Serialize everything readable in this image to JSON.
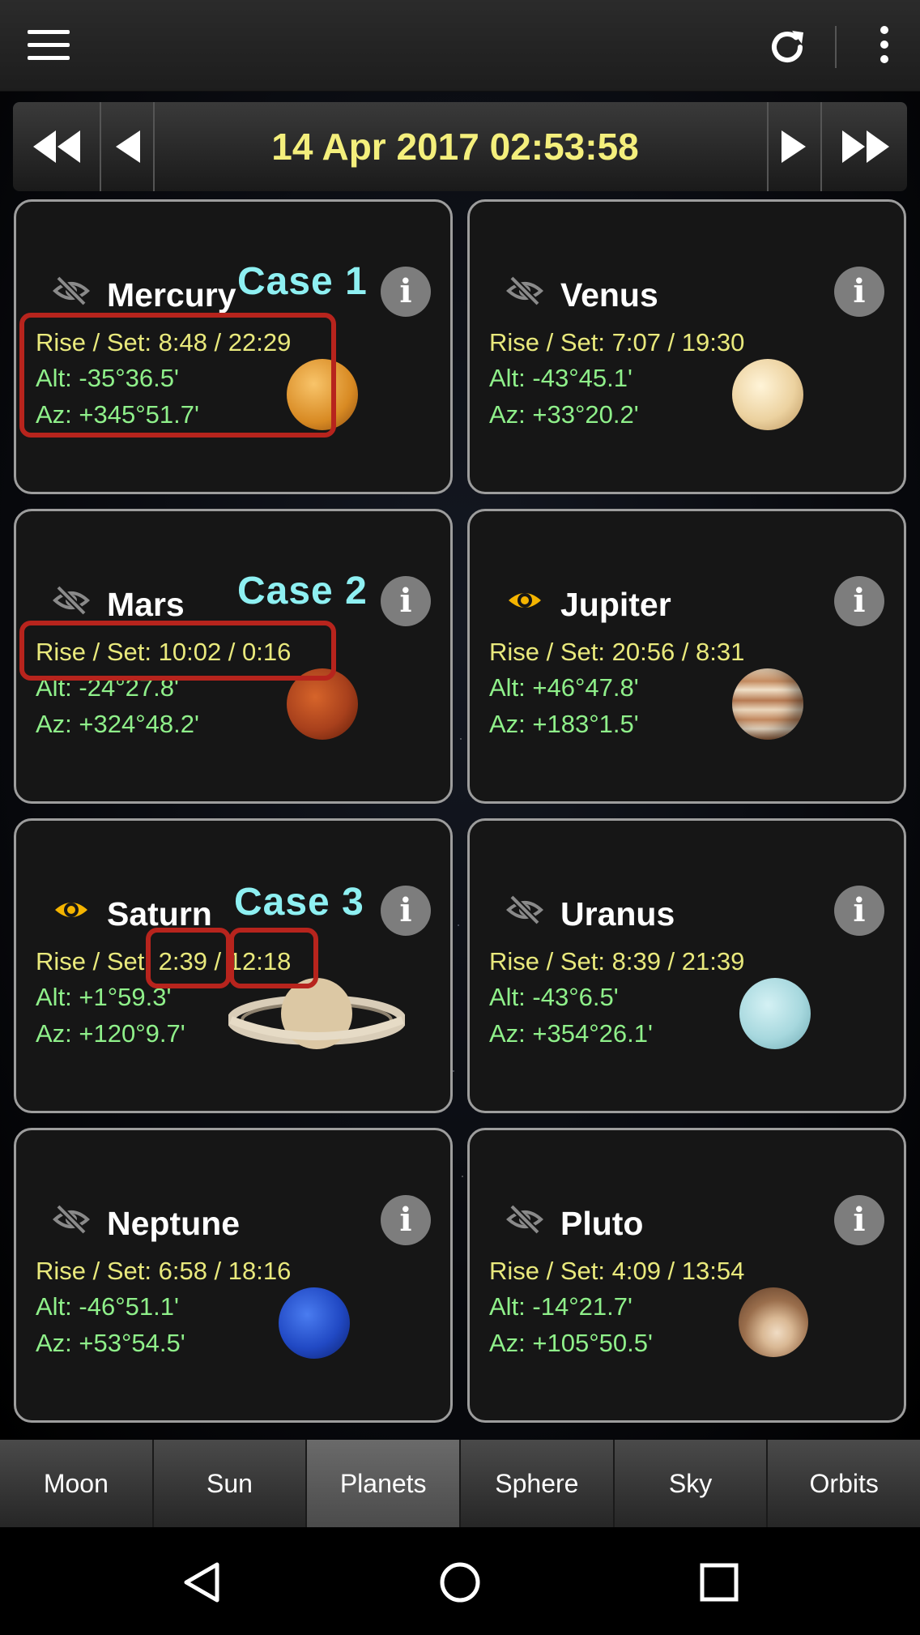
{
  "header": {
    "menu_icon": "hamburger-icon",
    "refresh_icon": "refresh-icon",
    "overflow_icon": "more-vert-icon"
  },
  "datebar": {
    "datetime": "14 Apr 2017 02:53:58",
    "buttons": [
      "fast-rewind-icon",
      "step-back-icon",
      "step-forward-icon",
      "fast-forward-icon"
    ]
  },
  "colors": {
    "rise_set": "#e9e97c",
    "alt_az": "#8ff08a",
    "visible_eye": "#f4b400",
    "hidden_eye": "#8a8a8a",
    "annotation_text": "#8ef0f2",
    "annotation_box": "#b7241d"
  },
  "planets": [
    {
      "name": "Mercury",
      "visible": false,
      "rise_set": "Rise / Set: 8:48 / 22:29",
      "alt": "Alt: -35°36.5'",
      "az": "Az: +345°51.7'"
    },
    {
      "name": "Venus",
      "visible": false,
      "rise_set": "Rise / Set: 7:07 / 19:30",
      "alt": "Alt: -43°45.1'",
      "az": "Az: +33°20.2'"
    },
    {
      "name": "Mars",
      "visible": false,
      "rise_set": "Rise / Set: 10:02 / 0:16",
      "alt": "Alt: -24°27.8'",
      "az": "Az: +324°48.2'"
    },
    {
      "name": "Jupiter",
      "visible": true,
      "rise_set": "Rise / Set: 20:56 / 8:31",
      "alt": "Alt: +46°47.8'",
      "az": "Az: +183°1.5'"
    },
    {
      "name": "Saturn",
      "visible": true,
      "rise_set": "Rise / Set: 2:39 / 12:18",
      "alt": "Alt: +1°59.3'",
      "az": "Az: +120°9.7'"
    },
    {
      "name": "Uranus",
      "visible": false,
      "rise_set": "Rise / Set: 8:39 / 21:39",
      "alt": "Alt: -43°6.5'",
      "az": "Az: +354°26.1'"
    },
    {
      "name": "Neptune",
      "visible": false,
      "rise_set": "Rise / Set: 6:58 / 18:16",
      "alt": "Alt: -46°51.1'",
      "az": "Az: +53°54.5'"
    },
    {
      "name": "Pluto",
      "visible": false,
      "rise_set": "Rise / Set: 4:09 / 13:54",
      "alt": "Alt: -14°21.7'",
      "az": "Az: +105°50.5'"
    }
  ],
  "info_glyph": "i",
  "annotations": [
    "Case 1",
    "Case 2",
    "Case 3"
  ],
  "tabs": [
    {
      "label": "Moon",
      "active": false
    },
    {
      "label": "Sun",
      "active": false
    },
    {
      "label": "Planets",
      "active": true
    },
    {
      "label": "Sphere",
      "active": false
    },
    {
      "label": "Sky",
      "active": false
    },
    {
      "label": "Orbits",
      "active": false
    }
  ],
  "system_nav": [
    "back-icon",
    "home-icon",
    "recents-icon"
  ]
}
